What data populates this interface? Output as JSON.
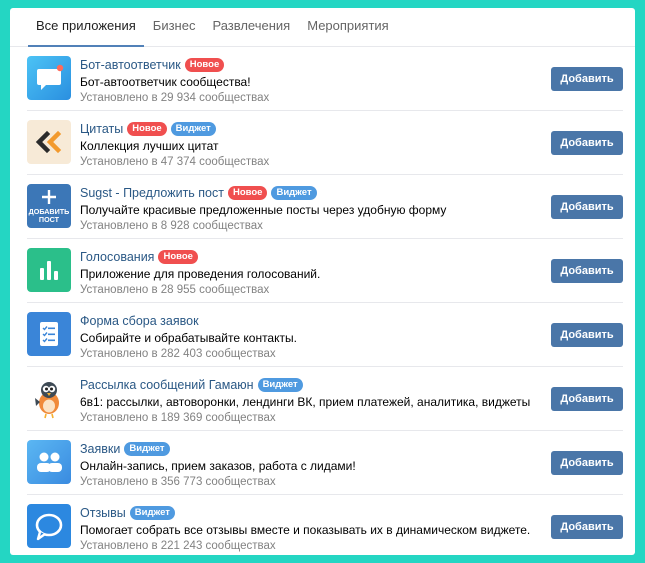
{
  "tabs": [
    {
      "label": "Все приложения",
      "active": true
    },
    {
      "label": "Бизнес",
      "active": false
    },
    {
      "label": "Развлечения",
      "active": false
    },
    {
      "label": "Мероприятия",
      "active": false
    }
  ],
  "badges": {
    "new": "Новое",
    "widget": "Виджет"
  },
  "apps": [
    {
      "name": "Бот-автоответчик",
      "desc": "Бот-автоответчик сообщества!",
      "installs": "Установлено в 29 934 сообществах",
      "button": "Добавить",
      "icon": "chat-bubble-icon"
    },
    {
      "name": "Цитаты",
      "desc": "Коллекция лучших цитат",
      "installs": "Установлено в 47 374 сообществах",
      "button": "Добавить",
      "icon": "quote-icon"
    },
    {
      "name": "Sugst - Предложить пост",
      "desc": "Получайте красивые предложенные посты через удобную форму",
      "installs": "Установлено в 8 928 сообществах",
      "button": "Добавить",
      "icon": "suggest-post-icon",
      "icon_text": [
        "ДОБАВИТЬ",
        "ПОСТ"
      ]
    },
    {
      "name": "Голосования",
      "desc": "Приложение для проведения голосований.",
      "installs": "Установлено в 28 955 сообществах",
      "button": "Добавить",
      "icon": "bar-chart-icon"
    },
    {
      "name": "Форма сбора заявок",
      "desc": "Собирайте и обрабатывайте контакты.",
      "installs": "Установлено в 282 403 сообществах",
      "button": "Добавить",
      "icon": "form-icon"
    },
    {
      "name": "Рассылка сообщений Гамаюн",
      "desc": "6в1: рассылки, автоворонки, лендинги ВК, прием платежей, аналитика, виджеты",
      "installs": "Установлено в 189 369 сообществах",
      "button": "Добавить",
      "icon": "bird-mascot-icon"
    },
    {
      "name": "Заявки",
      "desc": "Онлайн-запись, прием заказов, работа с лидами!",
      "installs": "Установлено в 356 773 сообществах",
      "button": "Добавить",
      "icon": "users-icon"
    },
    {
      "name": "Отзывы",
      "desc": "Помогает собрать все отзывы вместе и показывать их в динамическом виджете.",
      "installs": "Установлено в 221 243 сообществах",
      "button": "Добавить",
      "icon": "speech-bubble-icon"
    }
  ]
}
